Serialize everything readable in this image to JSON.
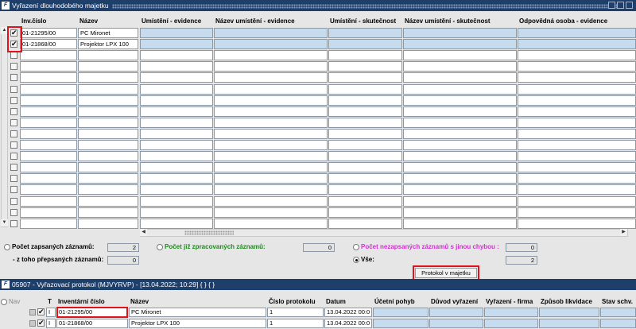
{
  "window1": {
    "title": "Vyřazení dlouhodobého majetku"
  },
  "grid": {
    "columns": [
      "Inv.číslo",
      "Název",
      "Umístění - evidence",
      "Název umístění - evidence",
      "Umístění - skutečnost",
      "Název umístění - skutečnost",
      "Odpovědná osoba - evidence"
    ],
    "rows": [
      {
        "checked": true,
        "inv": "01-21295/00",
        "name": "PC Mironet"
      },
      {
        "checked": true,
        "inv": "01-21868/00",
        "name": "Projektor LPX 100"
      }
    ],
    "empty_rows": 16
  },
  "stats": {
    "recorded_label": "Počet zapsaných záznamů:",
    "recorded_value": "2",
    "overwritten_label": "- z toho přepsaných záznamů:",
    "overwritten_value": "0",
    "processed_label": "Počet již zpracovaných záznamů:",
    "processed_value": "0",
    "error_label": "Počet nezapsaných záznamů s jinou chybou :",
    "error_value": "0",
    "all_label": "Vše:",
    "all_value": "2",
    "protocol_button": "Protokol v majetku",
    "colors": {
      "processed": "#1f8a1f",
      "error": "#d42fd4"
    }
  },
  "window2": {
    "title": "05907 - Vyřazovací protokol (MJVYRVP) - [13.04.2022; 10:29] { } { }",
    "nav_label": "Nav",
    "columns": [
      "T",
      "Inventární číslo",
      "Název",
      "Číslo protokolu",
      "Datum",
      "Účetní pohyb",
      "Důvod vyřazení",
      "Vyřazení - firma",
      "Způsob likvidace",
      "Stav schv."
    ],
    "rows": [
      {
        "checked": true,
        "t": "I",
        "inv": "01-21295/00",
        "name": "PC Mironet",
        "protocol": "1",
        "date": "13.04.2022 00:0"
      },
      {
        "checked": true,
        "t": "I",
        "inv": "01-21868/00",
        "name": "Projektor LPX 100",
        "protocol": "1",
        "date": "13.04.2022 00:0"
      }
    ]
  },
  "icons": [
    "app-icon",
    "scroll-up-icon",
    "scroll-down-icon",
    "scroll-left-icon",
    "scroll-right-icon",
    "minimize-icon",
    "maximize-icon",
    "close-icon"
  ]
}
